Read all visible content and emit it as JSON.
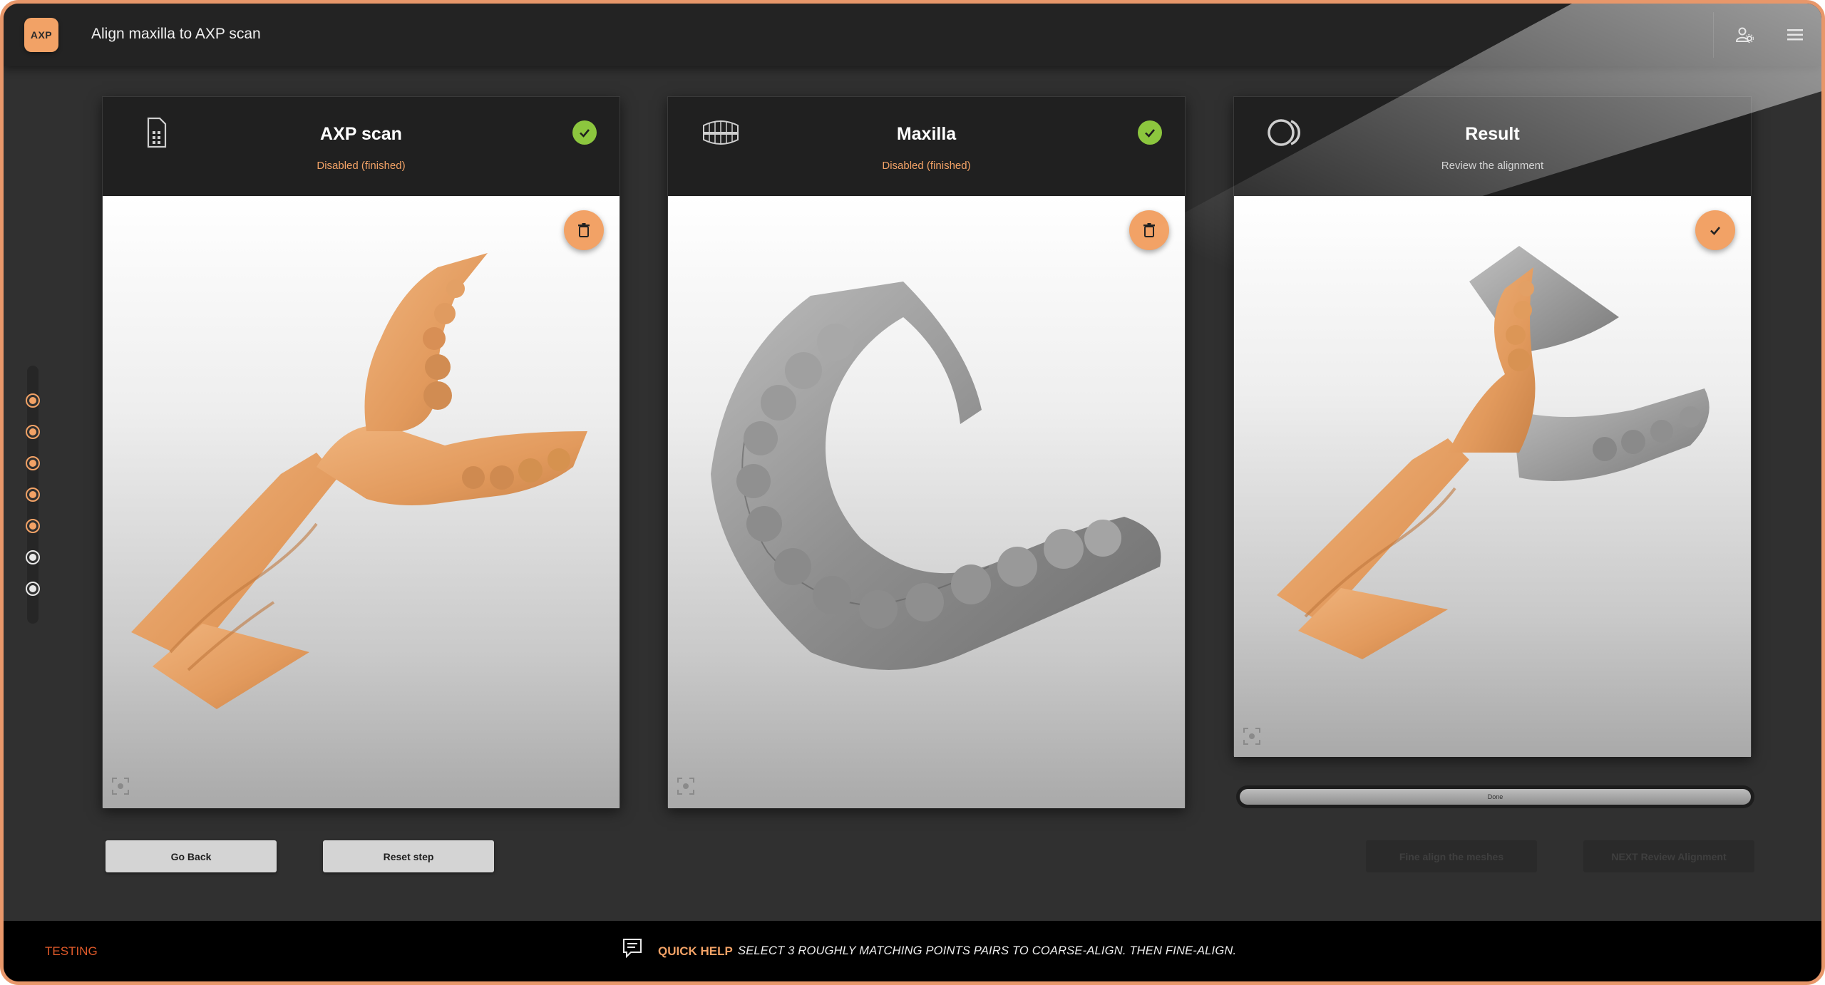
{
  "header": {
    "logo_text": "AXP",
    "title": "Align maxilla to AXP scan",
    "icons": [
      "user-settings-icon",
      "hamburger-menu-icon"
    ]
  },
  "stepper": {
    "steps": [
      {
        "state": "done"
      },
      {
        "state": "done"
      },
      {
        "state": "done"
      },
      {
        "state": "done"
      },
      {
        "state": "done"
      },
      {
        "state": "pending"
      },
      {
        "state": "pending"
      }
    ]
  },
  "panels": [
    {
      "title": "AXP scan",
      "subtitle": "Disabled (finished)",
      "icon": "scan-device-icon",
      "status": "complete",
      "action_icon": "trash-icon"
    },
    {
      "title": "Maxilla",
      "subtitle": "Disabled (finished)",
      "icon": "dental-arch-icon",
      "status": "complete",
      "action_icon": "trash-icon"
    },
    {
      "title": "Result",
      "subtitle": "Review the alignment",
      "icon": "overlap-circles-icon",
      "status": "",
      "action_icon": "check-icon"
    }
  ],
  "progress": {
    "label": "Done",
    "value": 1.0
  },
  "buttons": {
    "go_back": "Go Back",
    "reset_step": "Reset step",
    "fine_align": "Fine align the meshes",
    "next_review": "NEXT Review Alignment"
  },
  "footer": {
    "environment": "TESTING",
    "help_title": "QUICK HELP",
    "help_text": "SELECT 3 ROUGHLY MATCHING POINTS PAIRS TO COARSE-ALIGN. THEN FINE-ALIGN."
  },
  "colors": {
    "accent": "#f2a266",
    "success": "#8cc63e",
    "frame": "#e8976a",
    "testing": "#e05a2a"
  }
}
